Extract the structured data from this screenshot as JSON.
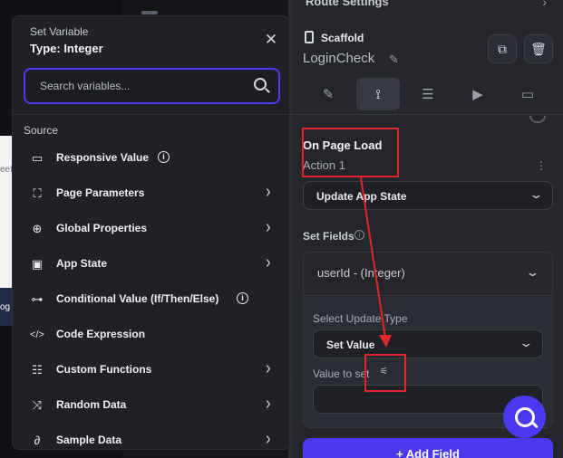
{
  "background": {
    "phone_text_top": "eet",
    "phone_text_bottom": "og"
  },
  "panel": {
    "route_title": "Route Settings",
    "scaffold_label": "Scaffold",
    "page_name": "LoginCheck",
    "tabs": [
      {
        "name": "tab-properties",
        "icon": "ruler-pencil-icon",
        "glyph": "✎"
      },
      {
        "name": "tab-actions",
        "icon": "action-flow-icon",
        "glyph": "⟟"
      },
      {
        "name": "tab-backend-query",
        "icon": "database-icon",
        "glyph": "☰"
      },
      {
        "name": "tab-animations",
        "icon": "play-icon",
        "glyph": "▶"
      },
      {
        "name": "tab-state",
        "icon": "state-icon",
        "glyph": "▭"
      }
    ],
    "on_page_load": "On Page Load",
    "action_label": "Action 1",
    "action_type": "Update App State",
    "set_fields": "Set Fields",
    "field_name": "userId - (Integer)",
    "select_update_type_label": "Select Update Type",
    "update_type_value": "Set Value",
    "value_to_set_label": "Value to set",
    "add_field_label": "+ Add Field"
  },
  "popup": {
    "subtitle": "Set Variable",
    "title": "Type: Integer",
    "search_placeholder": "Search variables...",
    "source_label": "Source",
    "items": [
      {
        "label": "Responsive Value",
        "icon": "responsive-icon",
        "glyph": "▭",
        "info": true,
        "chevron": false
      },
      {
        "label": "Page Parameters",
        "icon": "page-params-icon",
        "glyph": "⛶",
        "info": false,
        "chevron": true
      },
      {
        "label": "Global Properties",
        "icon": "globe-icon",
        "glyph": "⊕",
        "info": false,
        "chevron": true
      },
      {
        "label": "App State",
        "icon": "app-state-icon",
        "glyph": "▣",
        "info": false,
        "chevron": true
      },
      {
        "label": "Conditional Value (If/Then/Else)",
        "icon": "conditional-icon",
        "glyph": "⊶",
        "info": true,
        "chevron": false
      },
      {
        "label": "Code Expression",
        "icon": "code-icon",
        "glyph": "</>",
        "info": false,
        "chevron": false
      },
      {
        "label": "Custom Functions",
        "icon": "functions-icon",
        "glyph": "☷",
        "info": false,
        "chevron": true
      },
      {
        "label": "Random Data",
        "icon": "shuffle-icon",
        "glyph": "⤨",
        "info": false,
        "chevron": true
      },
      {
        "label": "Sample Data",
        "icon": "sample-data-icon",
        "glyph": "∂",
        "info": false,
        "chevron": true
      }
    ]
  },
  "colors": {
    "accent": "#4b39ef",
    "annotation": "#e0262b"
  }
}
